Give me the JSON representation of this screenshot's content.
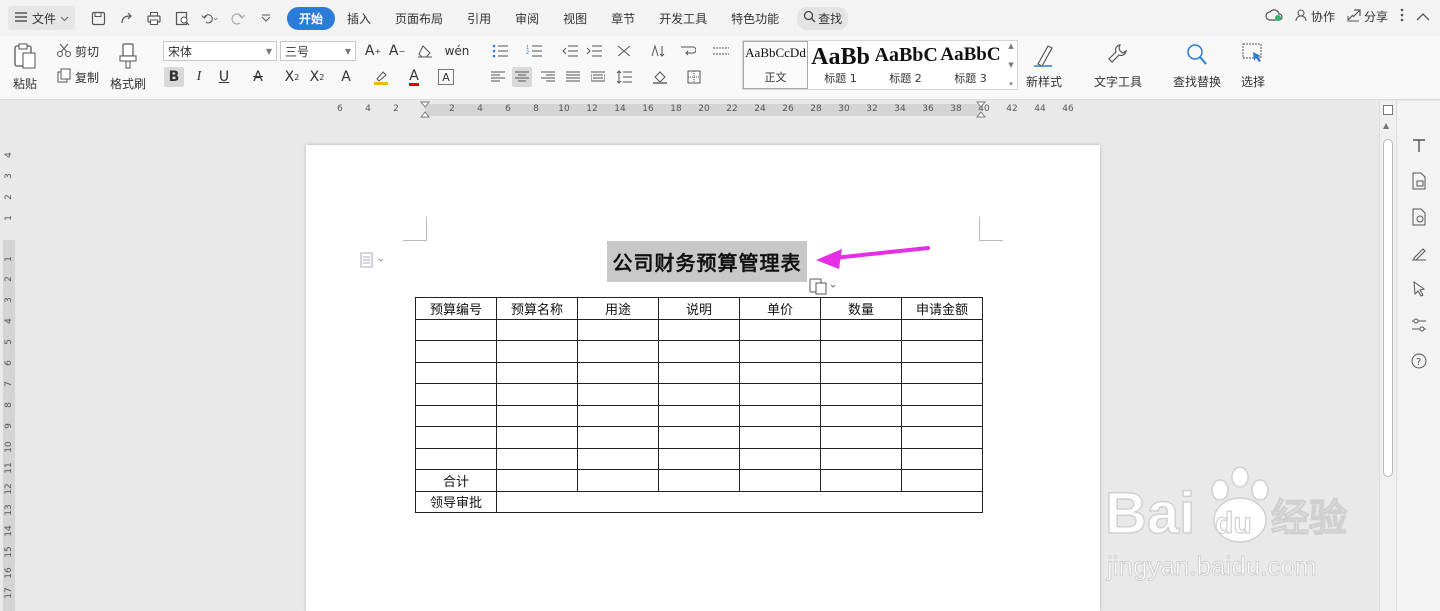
{
  "topbar": {
    "file_label": "文件",
    "tabs": [
      "开始",
      "插入",
      "页面布局",
      "引用",
      "审阅",
      "视图",
      "章节",
      "开发工具",
      "特色功能"
    ],
    "active_tab": "开始",
    "search_label": "查找",
    "collab_label": "协作",
    "share_label": "分享"
  },
  "ribbon": {
    "paste": "粘贴",
    "cut": "剪切",
    "copy": "复制",
    "format_painter": "格式刷",
    "font_name": "宋体",
    "font_size": "三号",
    "styles": [
      {
        "preview": "AaBbCcDd",
        "name": "正文"
      },
      {
        "preview": "AaBb",
        "name": "标题 1"
      },
      {
        "preview": "AaBbC",
        "name": "标题 2"
      },
      {
        "preview": "AaBbC",
        "name": "标题 3"
      }
    ],
    "new_style": "新样式",
    "text_tools": "文字工具",
    "find_replace": "查找替换",
    "select": "选择"
  },
  "ruler": {
    "h_ticks": [
      "6",
      "4",
      "2",
      "2",
      "4",
      "6",
      "8",
      "10",
      "12",
      "14",
      "16",
      "18",
      "20",
      "22",
      "24",
      "26",
      "28",
      "30",
      "32",
      "34",
      "36",
      "38",
      "40",
      "42",
      "44",
      "46"
    ],
    "v_ticks": [
      "4",
      "3",
      "2",
      "1",
      "1",
      "2",
      "3",
      "4",
      "5",
      "6",
      "7",
      "8",
      "9",
      "10",
      "11",
      "12",
      "13",
      "14",
      "15",
      "16",
      "17"
    ]
  },
  "document": {
    "title": "公司财务预算管理表",
    "headers": [
      "预算编号",
      "预算名称",
      "用途",
      "说明",
      "单价",
      "数量",
      "申请金额"
    ],
    "total_label": "合计",
    "approval_label": "领导审批"
  },
  "colors": {
    "accent": "#2b7bd9",
    "arrow": "#e62ee6",
    "selection": "#c8c8c8"
  },
  "watermark": {
    "brand": "Baidu",
    "cn": "经验",
    "url": "jingyan.baidu.com"
  }
}
